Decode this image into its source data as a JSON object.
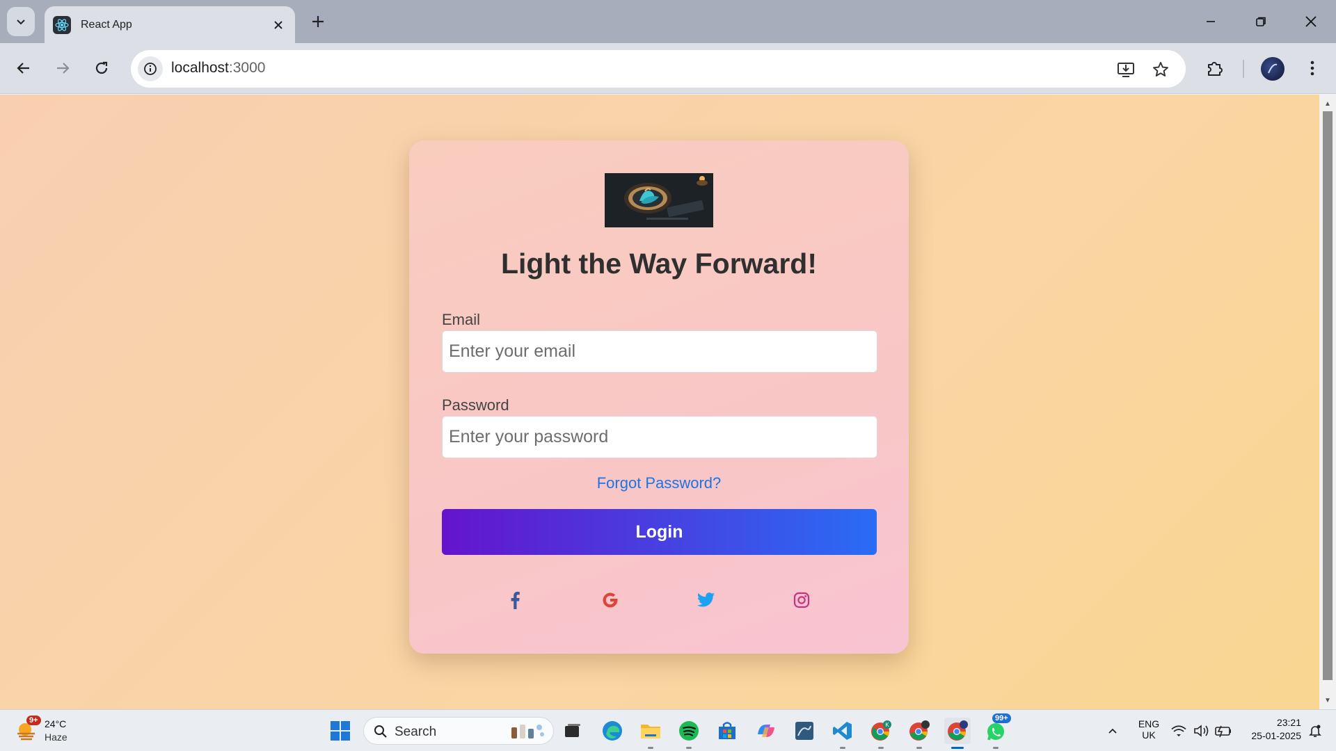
{
  "browser": {
    "tab_title": "React App",
    "url_host": "localhost",
    "url_port": ":3000"
  },
  "page": {
    "heading": "Light the Way Forward!",
    "email_label": "Email",
    "email_placeholder": "Enter your email",
    "password_label": "Password",
    "password_placeholder": "Enter your password",
    "forgot_link": "Forgot Password?",
    "login_button": "Login",
    "social_icons": [
      "facebook-icon",
      "google-icon",
      "twitter-icon",
      "instagram-icon"
    ],
    "colors": {
      "facebook": "#3b5998",
      "google": "#db4437",
      "twitter": "#1da1f2",
      "instagram": "#c13584",
      "link": "#1b74e4",
      "button_start": "#6414cc",
      "button_end": "#2a6cf5"
    }
  },
  "taskbar": {
    "weather_badge": "9+",
    "weather_temp": "24°C",
    "weather_desc": "Haze",
    "search_label": "Search",
    "whatsapp_badge": "99+",
    "language_line1": "ENG",
    "language_line2": "UK",
    "time": "23:21",
    "date": "25-01-2025"
  }
}
